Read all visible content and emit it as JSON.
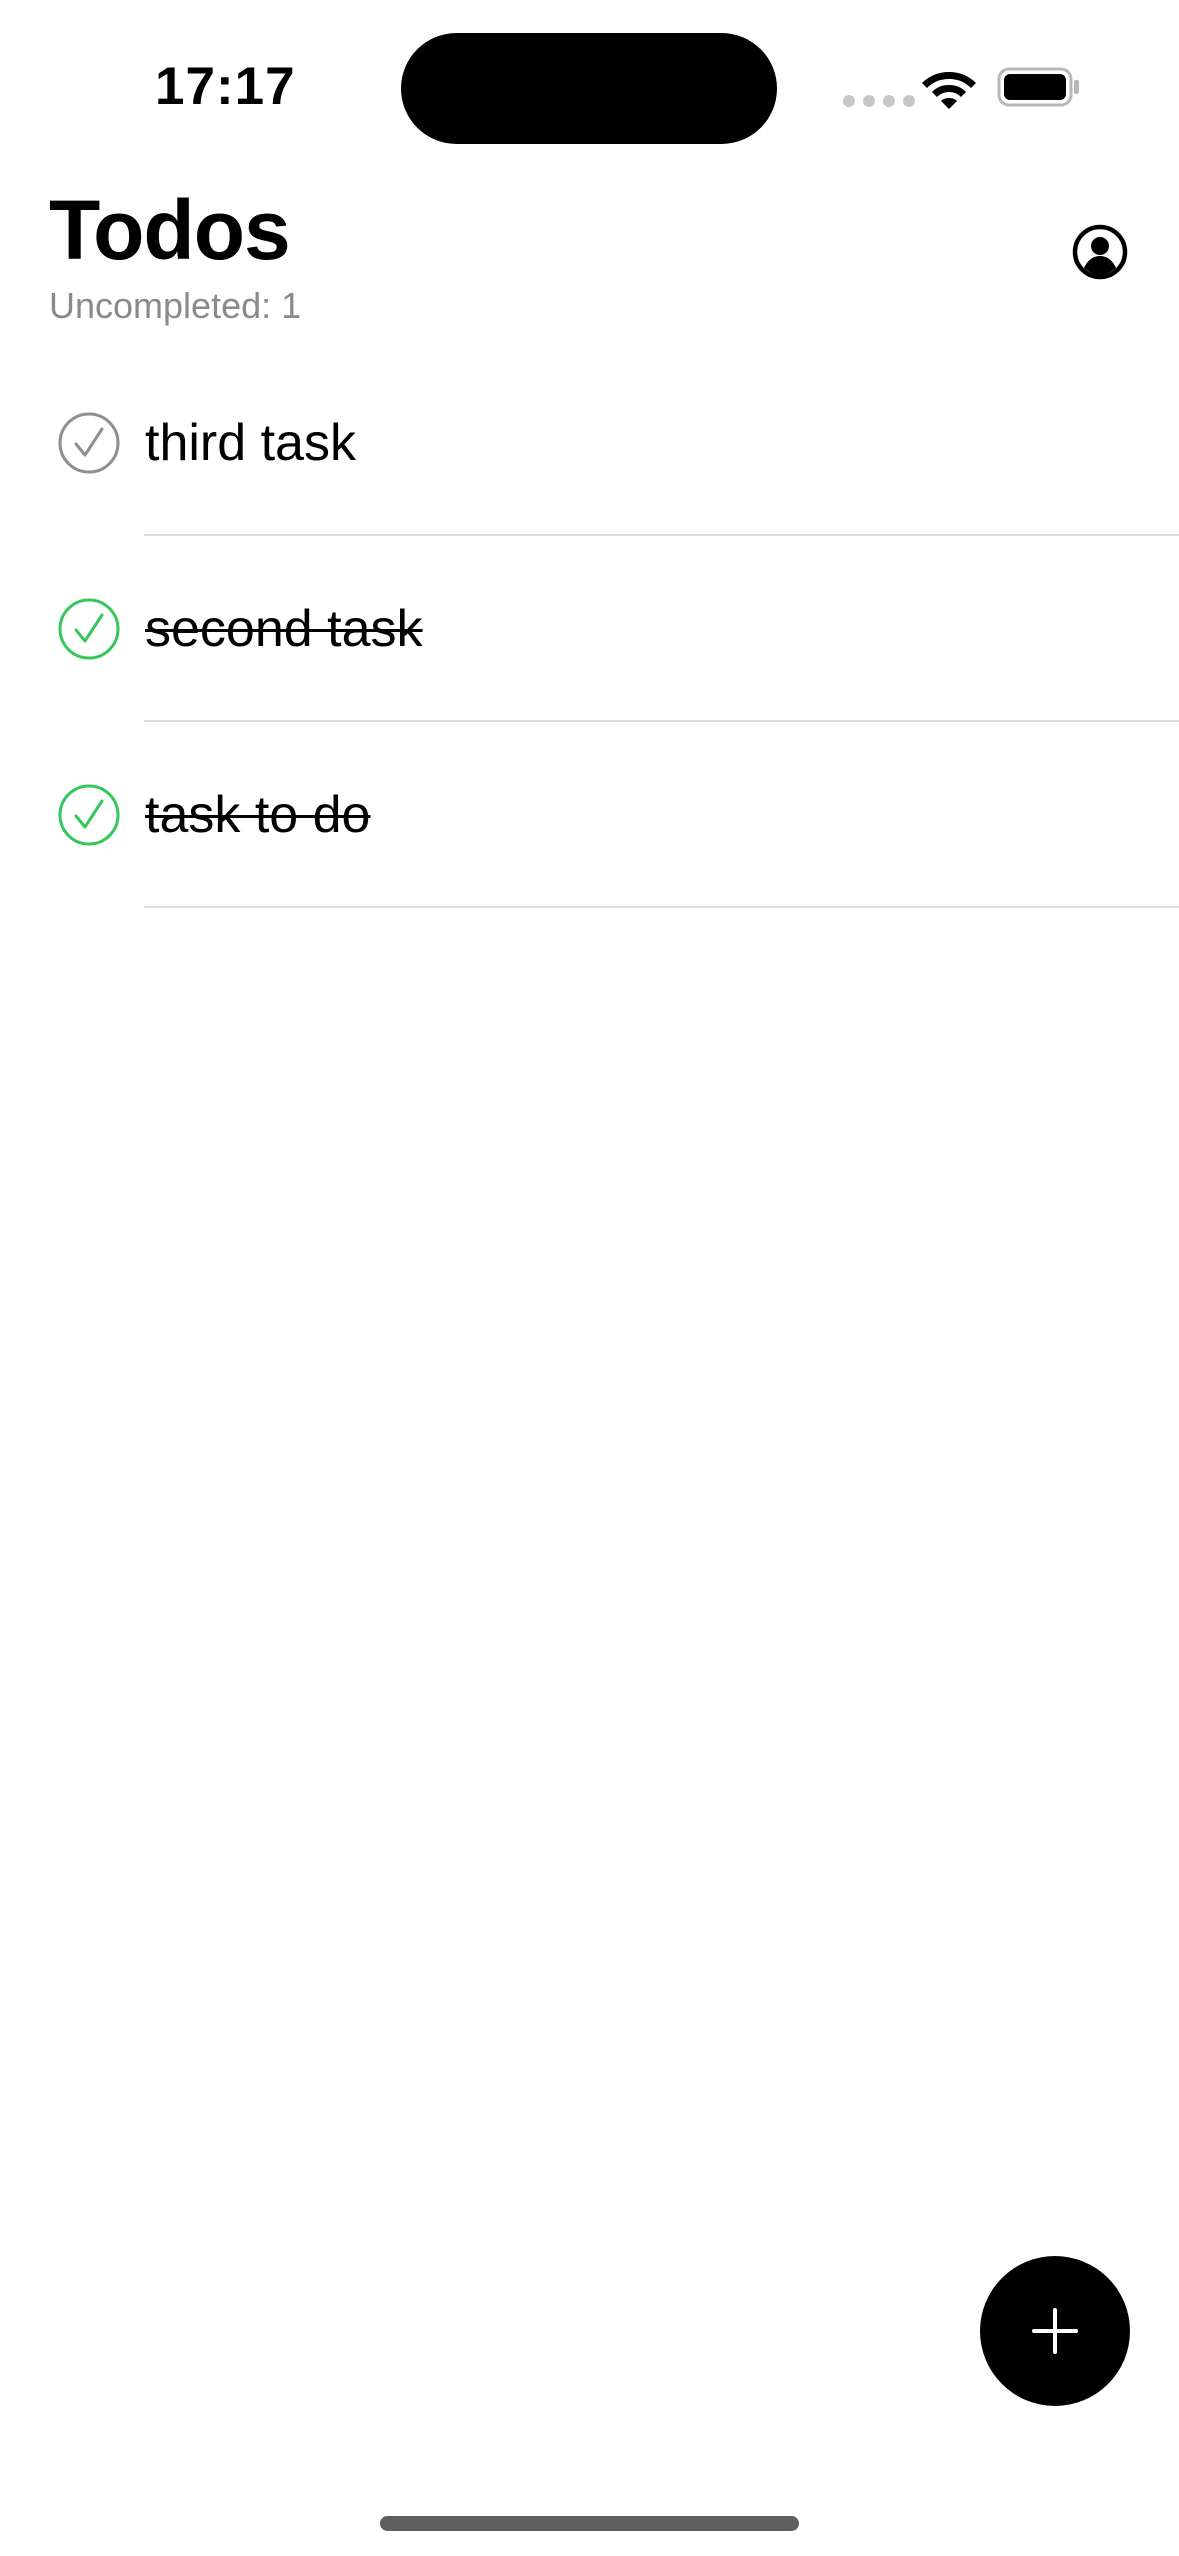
{
  "status_bar": {
    "time": "17:17",
    "wifi_icon": "wifi-icon",
    "battery_icon": "battery-icon"
  },
  "header": {
    "title": "Todos",
    "subtitle": "Uncompleted: 1",
    "profile_icon": "person-circle-icon"
  },
  "todos": [
    {
      "text": "third task",
      "completed": false
    },
    {
      "text": "second task",
      "completed": true
    },
    {
      "text": "task to do",
      "completed": true
    }
  ],
  "fab": {
    "icon": "plus-icon"
  },
  "colors": {
    "completed_check": "#34c759",
    "uncompleted_check": "#8e8e93",
    "subtitle": "#8a8a8e",
    "fab_background": "#000000"
  }
}
